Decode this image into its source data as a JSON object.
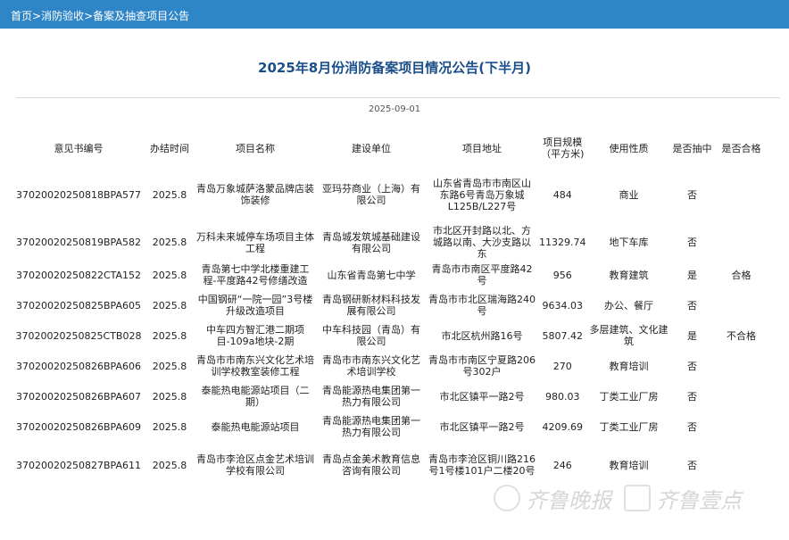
{
  "breadcrumb": {
    "home": "首页",
    "section": "消防验收",
    "page": "备案及抽查项目公告",
    "sep": ">"
  },
  "title": "2025年8月份消防备案项目情况公告(下半月)",
  "date": "2025-09-01",
  "headers": [
    "意见书编号",
    "办结时间",
    "项目名称",
    "建设单位",
    "项目地址",
    "项目规模（平方米)",
    "使用性质",
    "是否抽中",
    "是否合格"
  ],
  "rows": [
    {
      "id": "37020020250818BPA577",
      "time": "2025.8",
      "name": "青岛万象城萨洛蒙品牌店装饰装修",
      "unit": "亚玛芬商业（上海）有限公司",
      "addr": "山东省青岛市市南区山东路6号青岛万象城L125B/L227号",
      "size": "484",
      "use": "商业",
      "drawn": "否",
      "pass": ""
    },
    {
      "id": "37020020250819BPA582",
      "time": "2025.8",
      "name": "万科未来城停车场项目主体工程",
      "unit": "青岛城发筑城基础建设有限公司",
      "addr": "市北区开封路以北、方城路以南、大沙支路以东",
      "size": "11329.74",
      "use": "地下车库",
      "drawn": "否",
      "pass": ""
    },
    {
      "id": "37020020250822CTA152",
      "time": "2025.8",
      "name": "青岛第七中学北楼重建工程-平度路42号修缮改造",
      "unit": "山东省青岛第七中学",
      "addr": "青岛市市南区平度路42号",
      "size": "956",
      "use": "教育建筑",
      "drawn": "是",
      "pass": "合格"
    },
    {
      "id": "37020020250825BPA605",
      "time": "2025.8",
      "name": "中国钢研“一院一园”3号楼升级改造项目",
      "unit": "青岛钢研新材料科技发展有限公司",
      "addr": "青岛市市北区瑞海路240号",
      "size": "9634.03",
      "use": "办公、餐厅",
      "drawn": "否",
      "pass": ""
    },
    {
      "id": "37020020250825CTB028",
      "time": "2025.8",
      "name": "中车四方智汇港二期项目-109a地块-2期",
      "unit": "中车科技园（青岛）有限公司",
      "addr": "市北区杭州路16号",
      "size": "5807.42",
      "use": "多层建筑、文化建筑",
      "drawn": "是",
      "pass": "不合格"
    },
    {
      "id": "37020020250826BPA606",
      "time": "2025.8",
      "name": "青岛市市南东兴文化艺术培训学校教室装修工程",
      "unit": "青岛市市南东兴文化艺术培训学校",
      "addr": "青岛市市南区宁夏路206号302户",
      "size": "270",
      "use": "教育培训",
      "drawn": "否",
      "pass": ""
    },
    {
      "id": "37020020250826BPA607",
      "time": "2025.8",
      "name": "泰能热电能源站项目（二期）",
      "unit": "青岛能源热电集团第一热力有限公司",
      "addr": "市北区镇平一路2号",
      "size": "980.03",
      "use": "丁类工业厂房",
      "drawn": "否",
      "pass": ""
    },
    {
      "id": "37020020250826BPA609",
      "time": "2025.8",
      "name": "泰能热电能源站项目",
      "unit": "青岛能源热电集团第一热力有限公司",
      "addr": "市北区镇平一路2号",
      "size": "4209.69",
      "use": "丁类工业厂房",
      "drawn": "否",
      "pass": ""
    },
    {
      "id": "37020020250827BPA611",
      "time": "2025.8",
      "name": "青岛市李沧区点金艺术培训学校有限公司",
      "unit": "青岛点金美术教育信息咨询有限公司",
      "addr": "青岛市李沧区铜川路216号1号楼101户二楼20号",
      "size": "246",
      "use": "教育培训",
      "drawn": "否",
      "pass": ""
    }
  ],
  "watermark": {
    "left": "齐鲁晚报",
    "right": "齐鲁壹点"
  },
  "colors": {
    "topbar": "#2f86c7",
    "title": "#1b4f8a"
  }
}
